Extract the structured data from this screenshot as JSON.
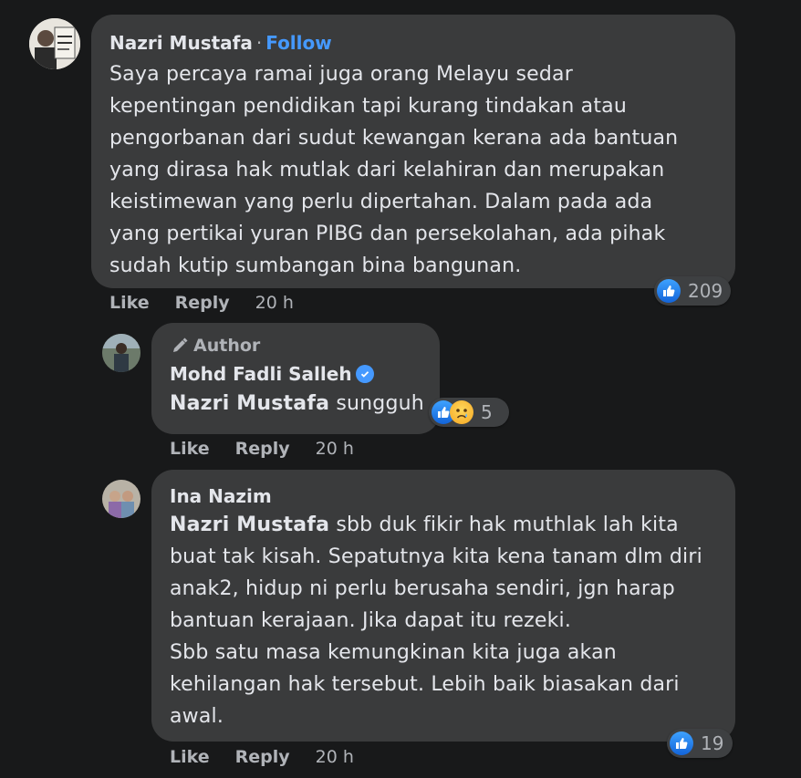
{
  "comment1": {
    "name": "Nazri Mustafa",
    "separator": "·",
    "follow_label": "Follow",
    "text": "Saya percaya ramai juga orang Melayu sedar\nkepentingan pendidikan tapi kurang tindakan atau\npengorbanan dari sudut kewangan kerana ada bantuan\nyang dirasa hak mutlak dari kelahiran dan merupakan\nkeistimewan yang perlu dipertahan. Dalam pada ada\nyang pertikai yuran PIBG dan persekolahan, ada pihak\nsudah kutip sumbangan bina bangunan.",
    "like_label": "Like",
    "reply_label": "Reply",
    "time": "20 h",
    "reaction_count": "209"
  },
  "reply1": {
    "badge": "Author",
    "name": "Mohd Fadli Salleh",
    "mention": "Nazri Mustafa",
    "text": " sungguh",
    "like_label": "Like",
    "reply_label": "Reply",
    "time": "20 h",
    "reaction_count": "5"
  },
  "reply2": {
    "name": "Ina Nazim",
    "mention": "Nazri Mustafa",
    "text": " sbb duk fikir hak muthlak lah kita\nbuat tak kisah. Sepatutnya kita kena tanam dlm diri\nanak2, hidup ni perlu berusaha sendiri, jgn harap\nbantuan kerajaan. Jika dapat itu rezeki.\nSbb satu masa kemungkinan kita juga akan\nkehilangan hak tersebut. Lebih baik biasakan dari\nawal.",
    "like_label": "Like",
    "reply_label": "Reply",
    "time": "20 h",
    "reaction_count": "19"
  },
  "colors": {
    "background": "#18191a",
    "bubble": "#3a3b3c",
    "link": "#4599ff",
    "secondary_text": "#b0b3b8"
  },
  "icons": [
    "like-icon",
    "sad-icon",
    "pencil-icon",
    "verified-icon"
  ]
}
